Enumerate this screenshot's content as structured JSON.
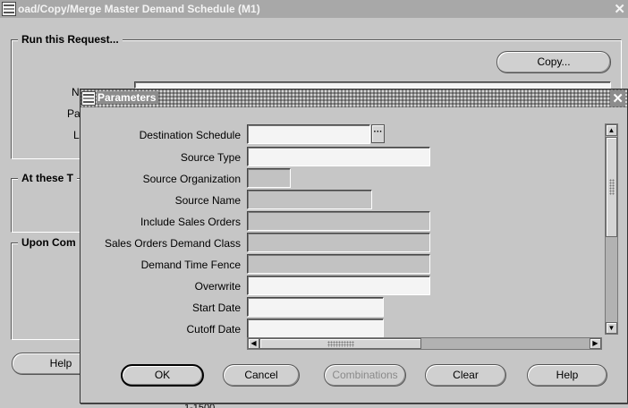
{
  "window": {
    "title": "oad/Copy/Merge Master Demand Schedule (M1)",
    "close_glyph": "✕"
  },
  "background": {
    "run_request_label": "Run this Request...",
    "at_these_label": "At these T",
    "upon_completion_label": "Upon Com",
    "copy_button_label": "Copy...",
    "help_button_label": "Help",
    "fragment_n": "N",
    "fragment_pa": "Pa",
    "fragment_l": "L",
    "fragment_bottom": "1-1500"
  },
  "dialog": {
    "title": "Parameters",
    "close_glyph": "✕",
    "fields": [
      {
        "label": "Destination Schedule",
        "value": "",
        "state": "editable",
        "has_lov": true
      },
      {
        "label": "Source Type",
        "value": "",
        "state": "editable",
        "has_lov": false
      },
      {
        "label": "Source Organization",
        "value": "",
        "state": "disabled",
        "has_lov": false
      },
      {
        "label": "Source Name",
        "value": "",
        "state": "disabled",
        "has_lov": false
      },
      {
        "label": "Include Sales Orders",
        "value": "",
        "state": "disabled",
        "has_lov": false
      },
      {
        "label": "Sales Orders Demand Class",
        "value": "",
        "state": "disabled",
        "has_lov": false
      },
      {
        "label": "Demand Time Fence",
        "value": "",
        "state": "disabled",
        "has_lov": false
      },
      {
        "label": "Overwrite",
        "value": "",
        "state": "editable",
        "has_lov": false
      },
      {
        "label": "Start Date",
        "value": "",
        "state": "editable",
        "has_lov": false
      },
      {
        "label": "Cutoff Date",
        "value": "",
        "state": "editable",
        "has_lov": false
      }
    ],
    "lov_glyph": "···",
    "buttons": {
      "ok": "OK",
      "cancel": "Cancel",
      "combinations": "Combinations",
      "clear": "Clear",
      "help": "Help"
    },
    "scroll_glyphs": {
      "up": "▲",
      "down": "▼",
      "left": "◀",
      "right": "▶"
    }
  }
}
